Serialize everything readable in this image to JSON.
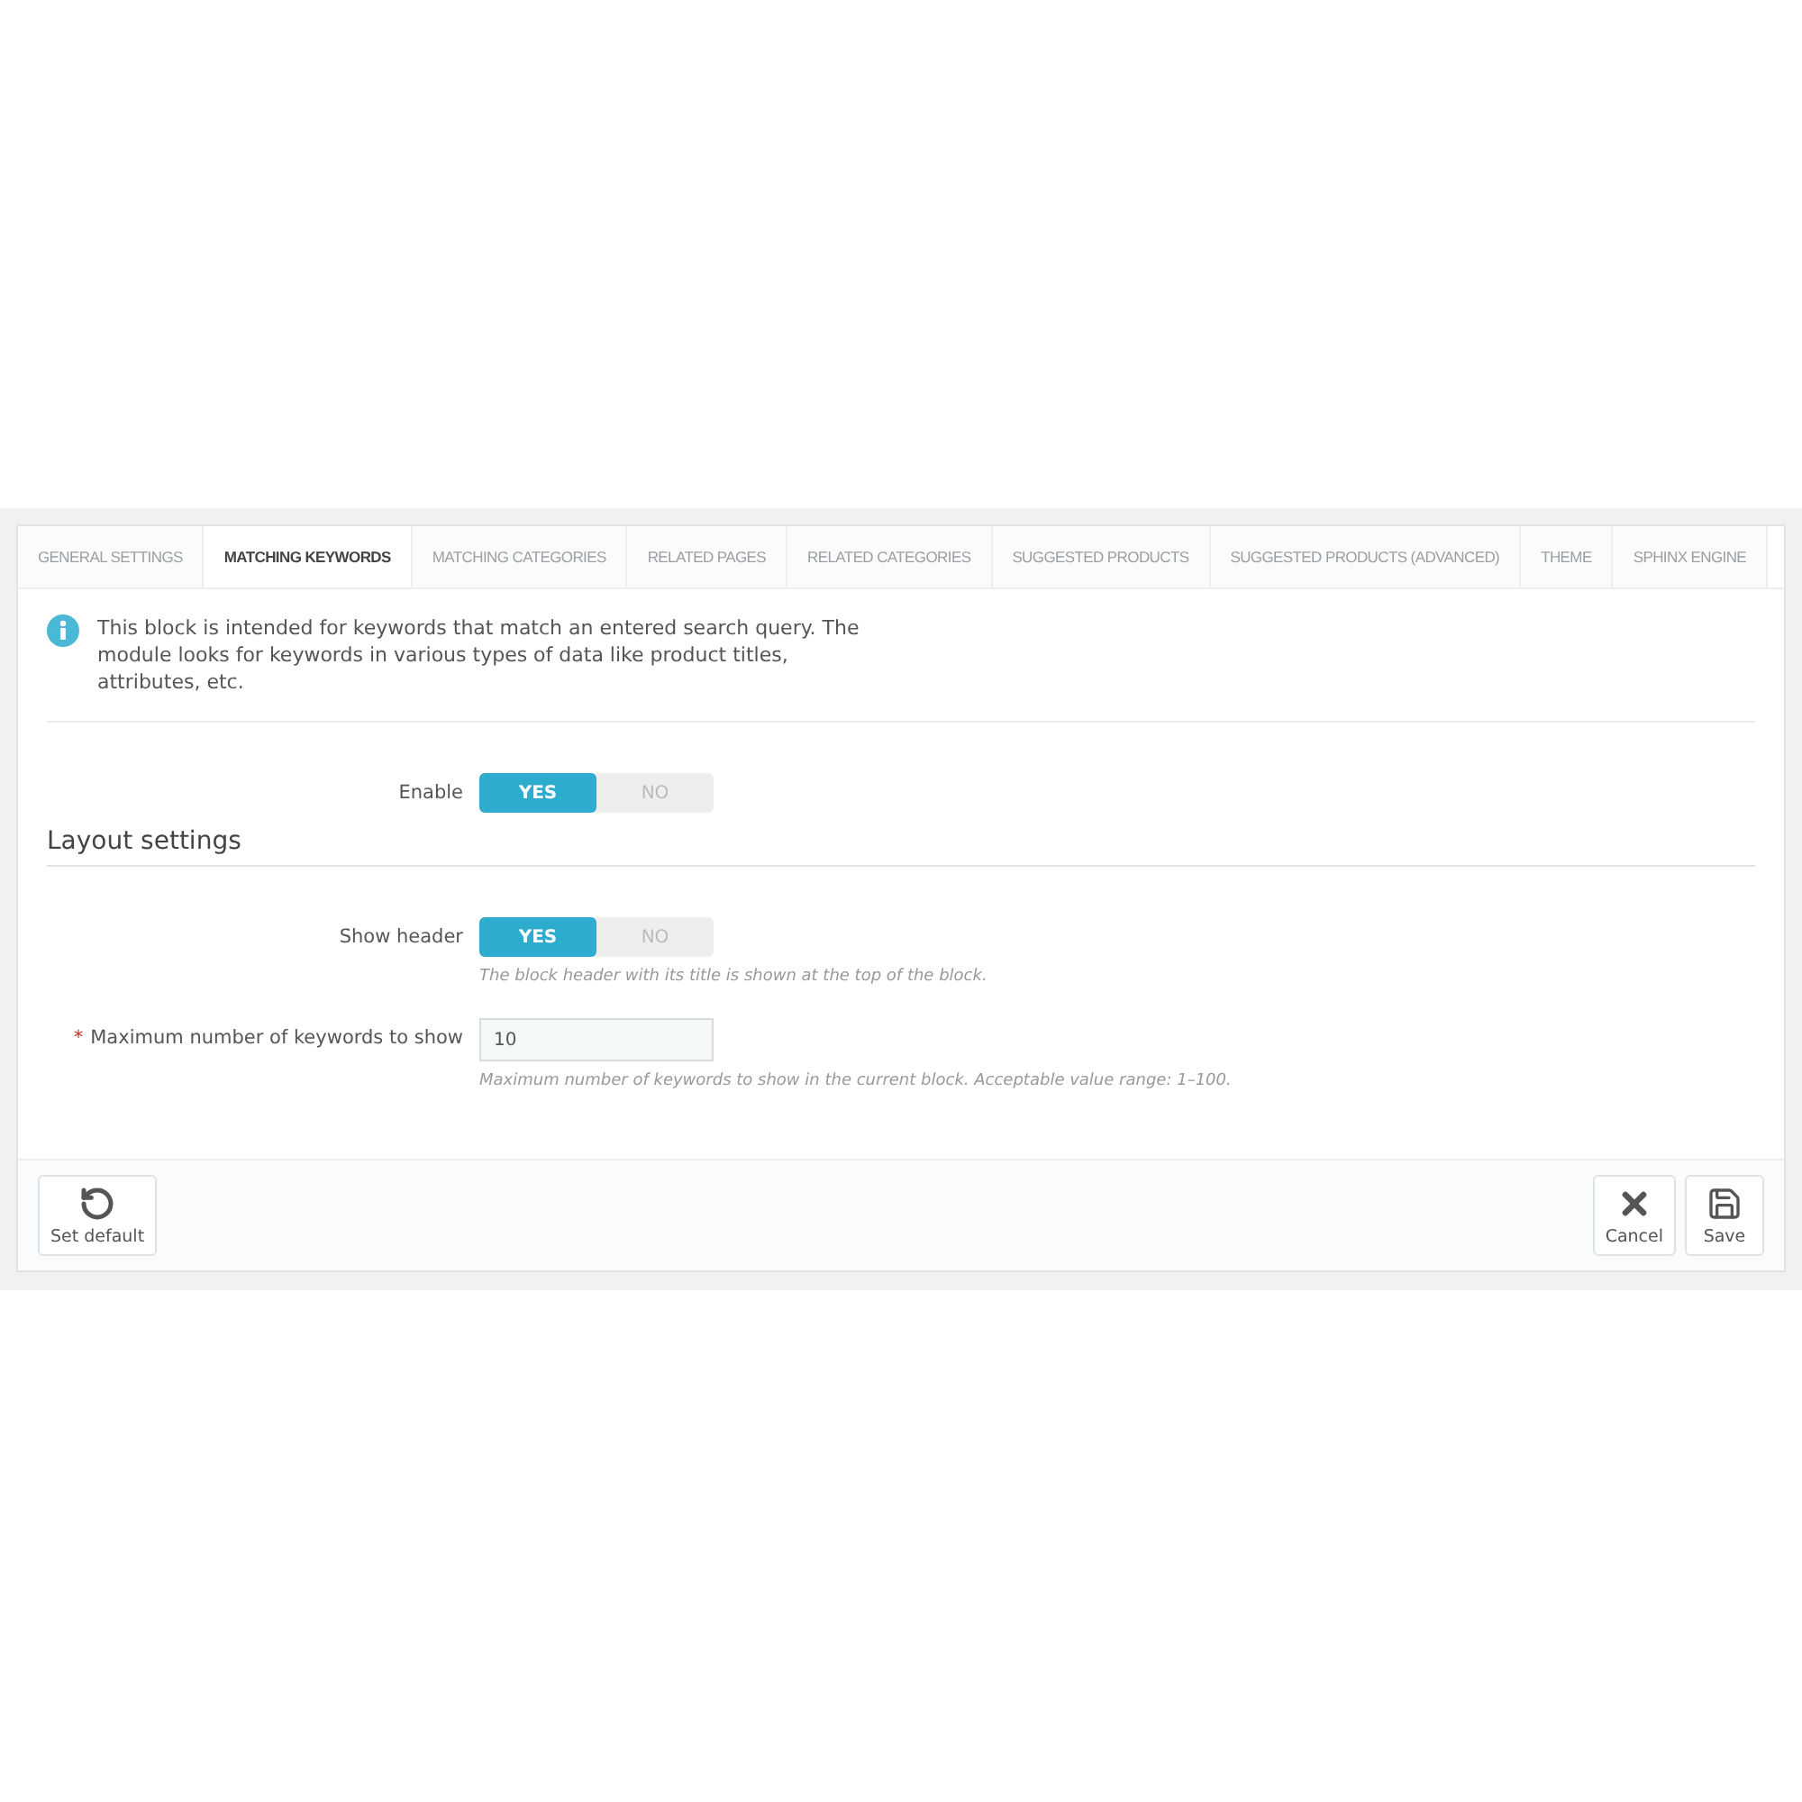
{
  "tabs": [
    {
      "label": "GENERAL SETTINGS",
      "selected": false
    },
    {
      "label": "MATCHING KEYWORDS",
      "selected": true
    },
    {
      "label": "MATCHING CATEGORIES",
      "selected": false
    },
    {
      "label": "RELATED PAGES",
      "selected": false
    },
    {
      "label": "RELATED CATEGORIES",
      "selected": false
    },
    {
      "label": "SUGGESTED PRODUCTS",
      "selected": false
    },
    {
      "label": "SUGGESTED PRODUCTS (ADVANCED)",
      "selected": false
    },
    {
      "label": "THEME",
      "selected": false
    },
    {
      "label": "SPHINX ENGINE",
      "selected": false
    }
  ],
  "info": "This block is intended for keywords that match an entered search query. The module looks for keywords in various types of data like product titles, attributes, etc.",
  "enable": {
    "label": "Enable",
    "options": [
      {
        "label": "YES",
        "selected": true
      },
      {
        "label": "NO",
        "selected": false
      }
    ]
  },
  "section_title": "Layout settings",
  "fields": [
    {
      "kind": "switch",
      "label": "Show header",
      "options": [
        {
          "label": "YES",
          "selected": true
        },
        {
          "label": "NO",
          "selected": false
        }
      ],
      "help": "The block header with its title is shown at the top of the block."
    },
    {
      "kind": "input",
      "label": "Maximum number of keywords to show",
      "required_mark": "*",
      "value": "10",
      "help": "Maximum number of keywords to show in the current block. Acceptable value range: 1–100."
    }
  ],
  "footer": {
    "set_default": "Set default",
    "cancel": "Cancel",
    "save": "Save"
  }
}
